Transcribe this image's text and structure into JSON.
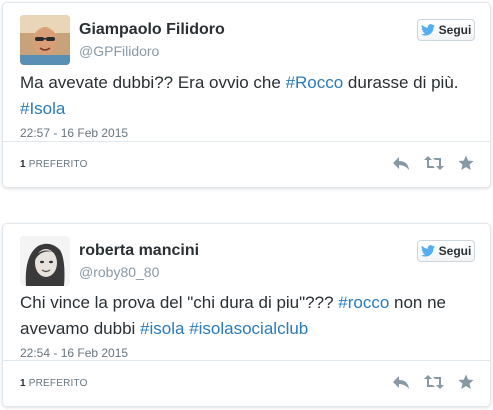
{
  "colors": {
    "link": "#2b7bb9",
    "muted": "#8899a6",
    "text": "#292f33",
    "icon": "#8899a6",
    "twitter_bird": "#55acee"
  },
  "tweets": [
    {
      "display_name": "Giampaolo Filidoro",
      "screen_name": "@GPFilidoro",
      "follow_label": "Segui",
      "text": [
        {
          "type": "text",
          "value": "Ma avevate dubbi?? Era ovvio che "
        },
        {
          "type": "hashtag",
          "value": "#Rocco"
        },
        {
          "type": "text",
          "value": " durasse di più. "
        },
        {
          "type": "hashtag",
          "value": "#Isola"
        }
      ],
      "timestamp": "22:57 - 16 Feb 2015",
      "favorites_count": "1",
      "favorites_label": "PREFERITO",
      "icons": {
        "reply": "reply-icon",
        "retweet": "retweet-icon",
        "favorite": "star-icon"
      }
    },
    {
      "display_name": "roberta mancini",
      "screen_name": "@roby80_80",
      "follow_label": "Segui",
      "text": [
        {
          "type": "text",
          "value": "Chi vince la prova del \"chi dura di piu\"??? "
        },
        {
          "type": "hashtag",
          "value": "#rocco"
        },
        {
          "type": "text",
          "value": " non ne avevamo dubbi "
        },
        {
          "type": "hashtag",
          "value": "#isola"
        },
        {
          "type": "text",
          "value": " "
        },
        {
          "type": "hashtag",
          "value": "#isolasocialclub"
        }
      ],
      "timestamp": "22:54 - 16 Feb 2015",
      "favorites_count": "1",
      "favorites_label": "PREFERITO",
      "icons": {
        "reply": "reply-icon",
        "retweet": "retweet-icon",
        "favorite": "star-icon"
      }
    }
  ]
}
